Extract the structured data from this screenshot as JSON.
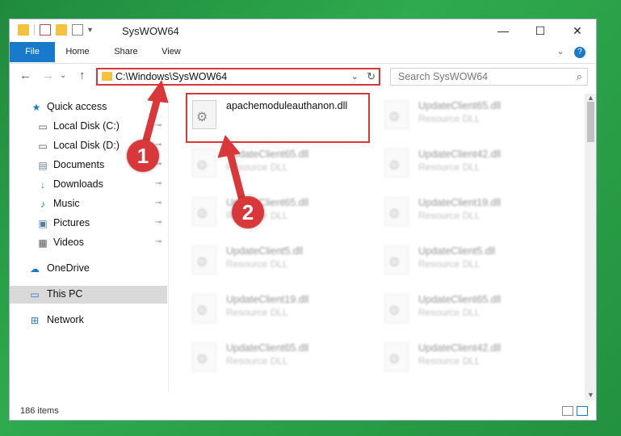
{
  "window": {
    "title": "SysWOW64",
    "controls": {
      "minimize": "—",
      "maximize": "☐",
      "close": "✕"
    }
  },
  "ribbon": {
    "tabs": [
      "File",
      "Home",
      "Share",
      "View"
    ],
    "help": "?",
    "expand": "⌄"
  },
  "address": {
    "path": "C:\\Windows\\SysWOW64",
    "dropdown": "⌄",
    "refresh": "↻"
  },
  "search": {
    "placeholder": "Search SysWOW64",
    "icon": "⌕"
  },
  "nav_buttons": {
    "back": "←",
    "forward": "→",
    "recent": "⌄",
    "up": "↑"
  },
  "sidebar": {
    "items": [
      {
        "label": "Quick access",
        "icon": "star-icon",
        "glyph": "★",
        "color": "#1979ca",
        "pinned": false
      },
      {
        "label": "Local Disk (C:)",
        "icon": "drive-icon",
        "glyph": "▭",
        "color": "#555",
        "pinned": true
      },
      {
        "label": "Local Disk (D:)",
        "icon": "drive-icon",
        "glyph": "▭",
        "color": "#555",
        "pinned": true
      },
      {
        "label": "Documents",
        "icon": "documents-icon",
        "glyph": "▤",
        "color": "#6a7f99",
        "pinned": true
      },
      {
        "label": "Downloads",
        "icon": "download-icon",
        "glyph": "↓",
        "color": "#1979ca",
        "pinned": true
      },
      {
        "label": "Music",
        "icon": "music-icon",
        "glyph": "♪",
        "color": "#1979ca",
        "pinned": true
      },
      {
        "label": "Pictures",
        "icon": "pictures-icon",
        "glyph": "▣",
        "color": "#4b7ba8",
        "pinned": true
      },
      {
        "label": "Videos",
        "icon": "videos-icon",
        "glyph": "▦",
        "color": "#555",
        "pinned": true
      },
      {
        "label": "OneDrive",
        "icon": "cloud-icon",
        "glyph": "☁",
        "color": "#1979ca",
        "pinned": false
      },
      {
        "label": "This PC",
        "icon": "computer-icon",
        "glyph": "▭",
        "color": "#1979ca",
        "pinned": false
      },
      {
        "label": "Network",
        "icon": "network-icon",
        "glyph": "⊞",
        "color": "#1979ca",
        "pinned": false
      }
    ],
    "pin_glyph": "⊸"
  },
  "files": {
    "highlighted": {
      "name": "apachemoduleauthanon.dll",
      "type": ""
    },
    "items": [
      {
        "name": "UpdateClient65.dll",
        "type": "Resource DLL"
      },
      {
        "name": "UpdateClient65.dll",
        "type": "Resource DLL"
      },
      {
        "name": "UpdateClient42.dll",
        "type": "Resource DLL"
      },
      {
        "name": "UpdateClient65.dll",
        "type": "Resource DLL"
      },
      {
        "name": "UpdateClient19.dll",
        "type": "Resource DLL"
      },
      {
        "name": "UpdateClient5.dll",
        "type": "Resource DLL"
      },
      {
        "name": "UpdateClient5.dll",
        "type": "Resource DLL"
      },
      {
        "name": "UpdateClient19.dll",
        "type": "Resource DLL"
      },
      {
        "name": "UpdateClient65.dll",
        "type": "Resource DLL"
      },
      {
        "name": "UpdateClient65.dll",
        "type": "Resource DLL"
      },
      {
        "name": "UpdateClient42.dll",
        "type": "Resource DLL"
      }
    ]
  },
  "status": {
    "item_count": "186 items"
  },
  "annotations": {
    "step1": "1",
    "step2": "2",
    "accent": "#d9383a"
  },
  "scroll": {
    "up": "▲",
    "down": "▼"
  }
}
